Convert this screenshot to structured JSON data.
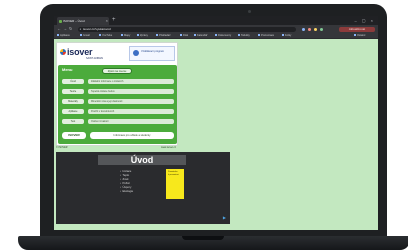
{
  "browser": {
    "tab_title": "ISOVER – Úvod",
    "tab_close": "×",
    "new_tab": "+",
    "window_controls": "– ▢ ×",
    "nav": {
      "back": "←",
      "forward": "→",
      "reload": "↻"
    },
    "address": "isover.cz/vyuka/uvod",
    "update_label": "Aktualizovat",
    "bookmarks": [
      "Aplikace",
      "Gmail",
      "YouTube",
      "Mapy",
      "Zprávy",
      "Překladač",
      "Disk",
      "Kalendář",
      "Dokumenty",
      "Tabulky",
      "Prezentace",
      "Fotky",
      "Ostatní"
    ]
  },
  "isover": {
    "logo": "isover",
    "logo_sub": "SAINT-GOBAIN",
    "partner_text": "Vzdělávací program",
    "menu_title": "Menu",
    "back_button": "Zpět na menu",
    "rows": [
      {
        "label": "Úvod",
        "value": "Základní informace o izolacích"
      },
      {
        "label": "Teorie",
        "value": "Tepelná izolace budov"
      },
      {
        "label": "Materiály",
        "value": "Minerální vlna a její vlastnosti"
      },
      {
        "label": "Aplikace",
        "value": "Použití v konstrukcích"
      },
      {
        "label": "Test",
        "value": "Ověření znalostí"
      }
    ],
    "footer_label": "ISOVER",
    "footer_value": "Informace pro učitele a studenty",
    "bottom_left": "© ISOVER",
    "bottom_right": "www.isover.cz"
  },
  "slide": {
    "title": "Úvod",
    "items": [
      "Izolace",
      "Teplo",
      "Zvuk",
      "Požár",
      "Úspory",
      "Ekologie"
    ],
    "note": "Poznámka\nk prezentaci",
    "nav_icon": "▶"
  },
  "colors": {
    "desktop": "#c3e8c0",
    "isover_green": "#4cab3c",
    "slide_bg": "#2a2b2e",
    "note_yellow": "#f7e81c"
  }
}
